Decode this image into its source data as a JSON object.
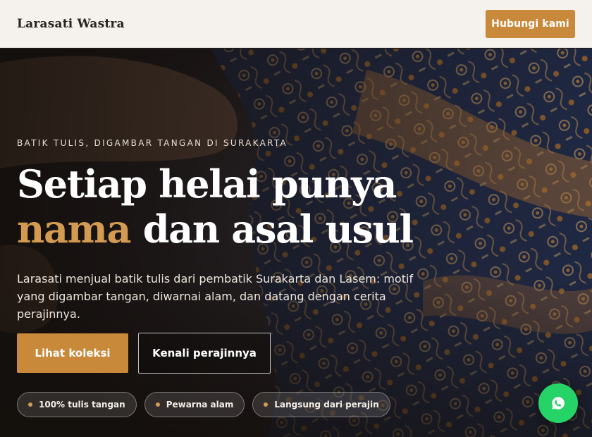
{
  "header": {
    "brand": "Larasati Wastra",
    "contact_label": "Hubungi kami"
  },
  "hero": {
    "kicker": "BATIK TULIS, DIGAMBAR TANGAN DI SURAKARTA",
    "headline_line1": "Setiap helai punya",
    "headline_accent": "nama",
    "headline_rest": "dan asal usul",
    "lede": "Larasati menjual batik tulis dari pembatik Surakarta dan Lasem: motif yang digambar tangan, diwarnai alam, dan datang dengan cerita perajinnya.",
    "primary_cta": "Lihat koleksi",
    "secondary_cta": "Kenali perajinnya",
    "features": [
      "100% tulis tangan",
      "Pewarna alam",
      "Langsung dari perajin"
    ]
  },
  "floating": {
    "whatsapp_icon": "whatsapp-icon"
  },
  "colors": {
    "accent": "#c9893a",
    "header_bg": "#f5f1ec",
    "whatsapp": "#25d366"
  }
}
